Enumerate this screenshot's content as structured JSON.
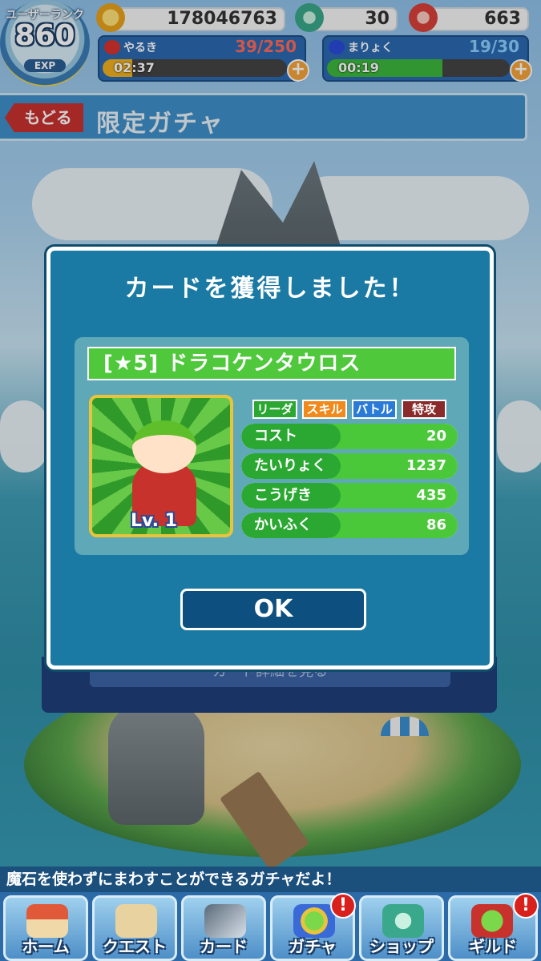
{
  "hud": {
    "rank_label": "ユーザーランク",
    "rank_value": "860",
    "exp_label": "EXP",
    "coins": "178046763",
    "gems": "30",
    "meat": "663",
    "stamina": {
      "label": "やるき",
      "value": "39/250",
      "timer": "02:37",
      "fill": 0.16
    },
    "mana": {
      "label": "まりょく",
      "value": "19/30",
      "timer": "00:19",
      "fill": 0.63
    },
    "plus": "+"
  },
  "titlebar": {
    "back_label": "もどる",
    "title": "限定ガチャ"
  },
  "behind_button": "カード詳細を見る",
  "modal": {
    "title": "カードを獲得しました！",
    "card_name": "[★5] ドラコケンタウロス",
    "level": "Lv. 1",
    "tags": [
      {
        "label": "リーダー",
        "color": "#2aa832"
      },
      {
        "label": "スキル",
        "color": "#f08a1c"
      },
      {
        "label": "バトル",
        "color": "#2a7ad8"
      },
      {
        "label": "特攻",
        "color": "#8a2a2a"
      }
    ],
    "stats": [
      {
        "label": "コスト",
        "value": "20"
      },
      {
        "label": "たいりょく",
        "value": "1237"
      },
      {
        "label": "こうげき",
        "value": "435"
      },
      {
        "label": "かいふく",
        "value": "86"
      }
    ],
    "ok_label": "OK"
  },
  "ticker": "魔石を使わずにまわすことができるガチャだよ！",
  "nav": [
    {
      "label": "ホーム",
      "icon": "house-icon",
      "alert": ""
    },
    {
      "label": "クエスト",
      "icon": "map-icon",
      "alert": ""
    },
    {
      "label": "カード",
      "icon": "cards-icon",
      "alert": ""
    },
    {
      "label": "ガチャ",
      "icon": "gacha-icon",
      "alert": "!"
    },
    {
      "label": "ショップ",
      "icon": "gem-shop-icon",
      "alert": ""
    },
    {
      "label": "ギルド",
      "icon": "guild-icon",
      "alert": "!"
    }
  ],
  "colors": {
    "accent_blue": "#1a7aa3",
    "stat_green": "#2aa832",
    "back_red": "#c9322f",
    "alert_red": "#d8201c"
  }
}
